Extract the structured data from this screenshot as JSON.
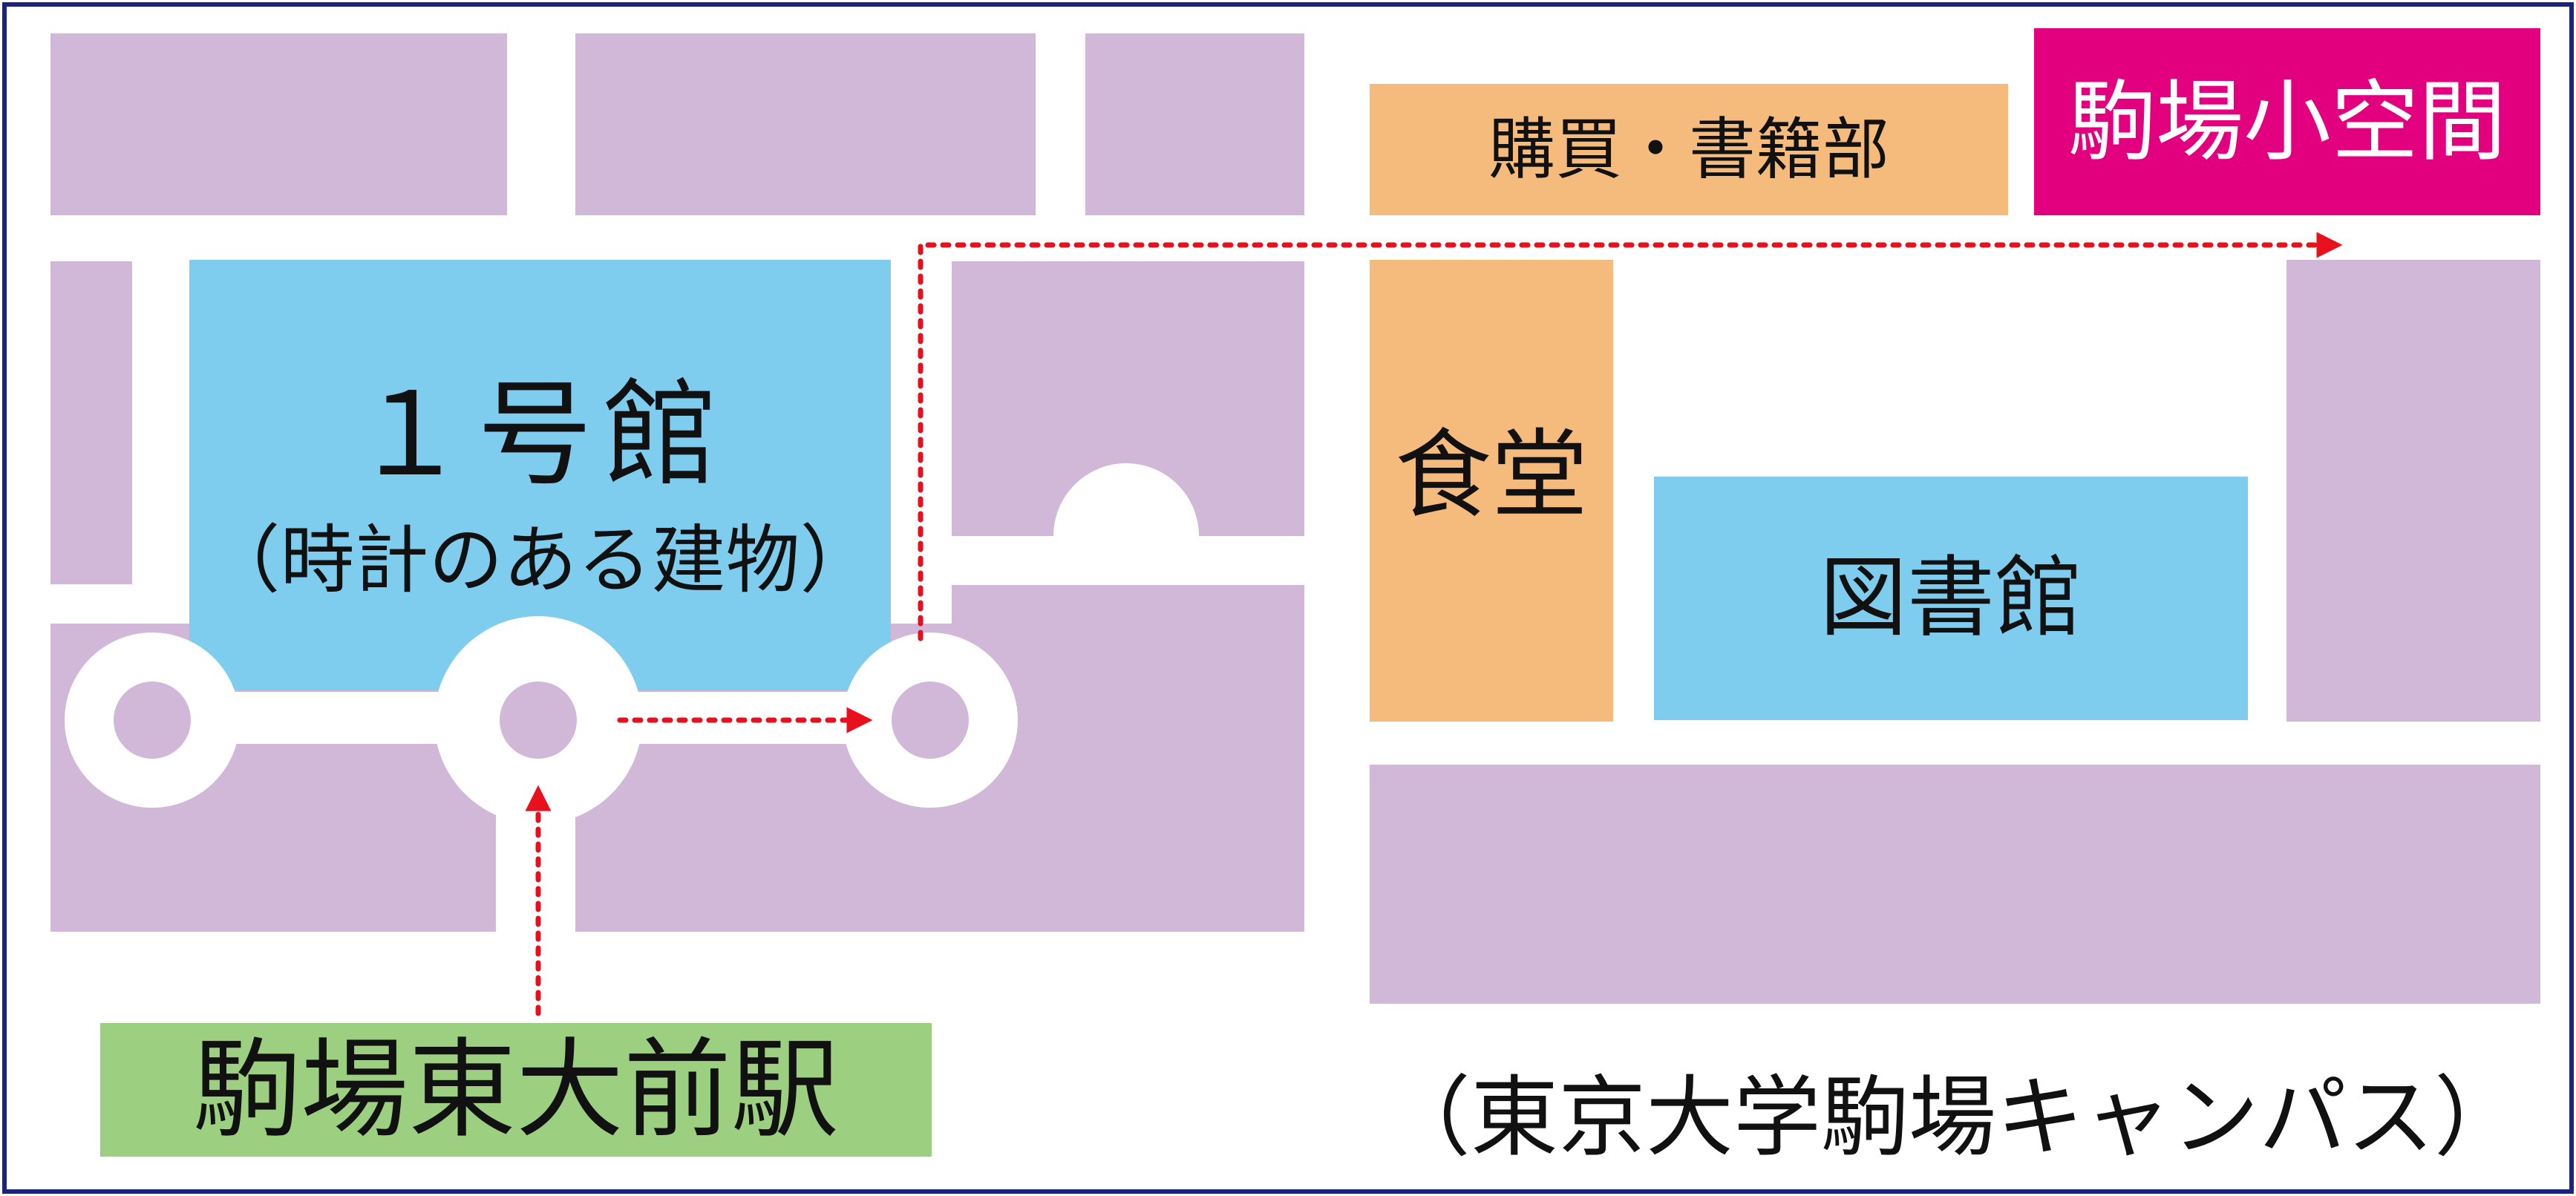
{
  "colors": {
    "building": "#d1b8d9",
    "highlight_building": "#7ecdef",
    "shop": "#f5bb7c",
    "destination": "#e3007f",
    "station": "#9ccf80",
    "route_arrow": "#e8101c",
    "border": "#1a237e",
    "road": "#ffffff"
  },
  "labels": {
    "building1_name": "１号館",
    "building1_note": "（時計のある建物）",
    "shop": "購買・書籍部",
    "destination": "駒場小空間",
    "cafeteria": "食堂",
    "library": "図書館",
    "station": "駒場東大前駅",
    "campus": "（東京大学駒場キャンパス）"
  },
  "icons": {
    "route": "dotted-arrow-route",
    "roundabout": "roundabout-circle"
  }
}
